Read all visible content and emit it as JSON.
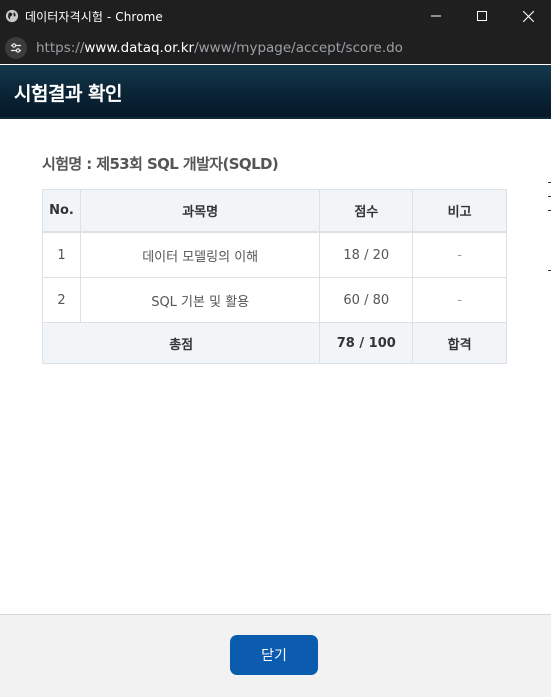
{
  "window": {
    "title": "데이터자격시험 - Chrome"
  },
  "address_bar": {
    "scheme": "https://",
    "host": "www.dataq.or.kr",
    "path": "/www/mypage/accept/score.do"
  },
  "page": {
    "header_title": "시험결과 확인",
    "exam_name": "시험명 : 제53회 SQL 개발자(SQLD)"
  },
  "score_table": {
    "columns": [
      "No.",
      "과목명",
      "점수",
      "비고"
    ],
    "rows": [
      {
        "no": "1",
        "subject": "데이터 모델링의 이해",
        "score": "18 / 20",
        "note": "-"
      },
      {
        "no": "2",
        "subject": "SQL 기본 및 활용",
        "score": "60 / 80",
        "note": "-"
      }
    ],
    "total": {
      "label": "총점",
      "score": "78 / 100",
      "result": "합격"
    }
  },
  "footer": {
    "close_label": "닫기"
  },
  "colors": {
    "header_bg": "#0a2435",
    "button_bg": "#0b5cae",
    "table_header_bg": "#f2f5f8"
  },
  "icons": [
    "globe-icon",
    "minimize-icon",
    "maximize-icon",
    "close-icon",
    "site-info-icon"
  ]
}
